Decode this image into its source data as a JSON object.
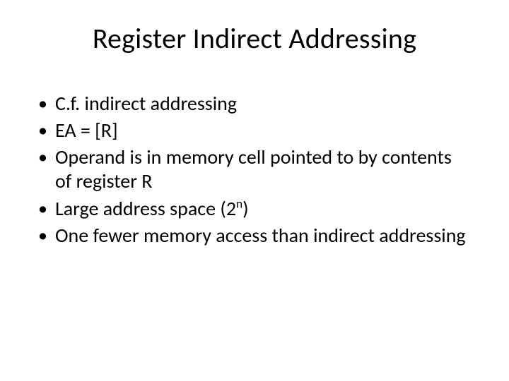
{
  "title": "Register Indirect Addressing",
  "bullets": [
    {
      "text": "C.f. indirect addressing"
    },
    {
      "text": "EA = [R]"
    },
    {
      "text": "Operand is in memory cell pointed to by contents of register R"
    },
    {
      "prefix": "Large address space (2",
      "sup": "n",
      "suffix": ")"
    },
    {
      "text": "One fewer memory access than indirect addressing"
    }
  ]
}
